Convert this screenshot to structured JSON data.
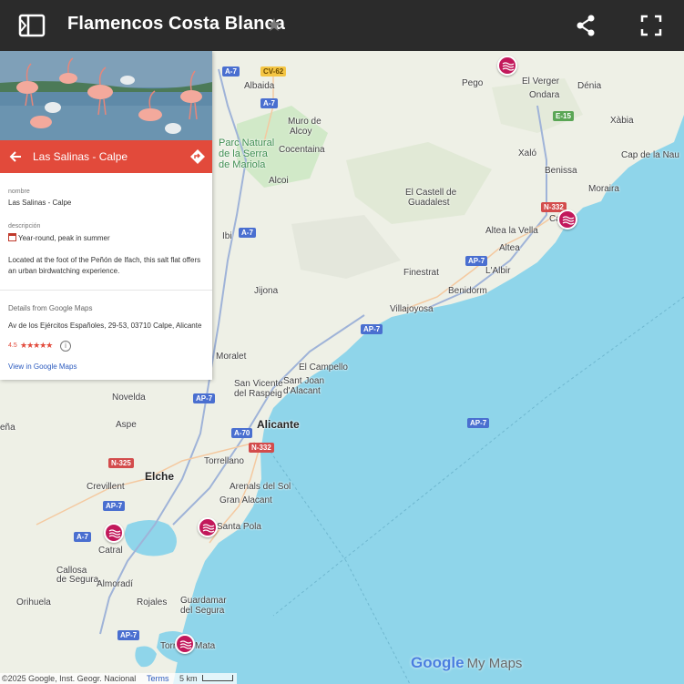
{
  "header": {
    "title": "Flamencos Costa Blanca",
    "icons": [
      "panel-toggle-icon",
      "star-icon",
      "share-icon",
      "fullscreen-icon"
    ]
  },
  "panel": {
    "title": "Las Salinas - Calpe",
    "name_label": "nombre",
    "name_value": "Las Salinas - Calpe",
    "desc_label": "descripción",
    "desc_value": "Year-round, peak in summer",
    "description": "Located at the foot of the Peñón de Ifach, this salt flat offers an urban birdwatching experience.",
    "details_label": "Details from Google Maps",
    "address": "Av de los Ejércitos Españoles, 29-53, 03710 Calpe, Alicante",
    "rating": "4.5",
    "stars": "★★★★★",
    "gmaps_link": "View in Google Maps",
    "accent": "#e24a3b"
  },
  "map": {
    "places": [
      {
        "name": "Villajoyosa"
      },
      {
        "name": "Pego"
      },
      {
        "name": "El Verger"
      },
      {
        "name": "Dénia"
      },
      {
        "name": "Ondara"
      },
      {
        "name": "Albaida"
      },
      {
        "name": "Xàbia"
      },
      {
        "name": "Muro de"
      },
      {
        "name": "Alcoy"
      },
      {
        "name": "Cocentaina"
      },
      {
        "name": "Xaló"
      },
      {
        "name": "Cap de la Nau"
      },
      {
        "name": "Alcoi"
      },
      {
        "name": "Benissa"
      },
      {
        "name": "Moraira"
      },
      {
        "name": "El Castell de"
      },
      {
        "name": "Guadalest"
      },
      {
        "name": "Altea la Vella"
      },
      {
        "name": "Ca"
      },
      {
        "name": "Ibi"
      },
      {
        "name": "Altea"
      },
      {
        "name": "Finestrat"
      },
      {
        "name": "L'Albir"
      },
      {
        "name": "Benidorm"
      },
      {
        "name": "Jijona"
      },
      {
        "name": "Villajoyosa"
      },
      {
        "name": "Moralet"
      },
      {
        "name": "El Campello"
      },
      {
        "name": "San Vicente"
      },
      {
        "name": "del Raspeig"
      },
      {
        "name": "Sant Joan"
      },
      {
        "name": "d'Alacant"
      },
      {
        "name": "Novelda"
      },
      {
        "name": "Aspe"
      },
      {
        "name": "Alicante"
      },
      {
        "name": "eña"
      },
      {
        "name": "Torrellano"
      },
      {
        "name": "Elche"
      },
      {
        "name": "Crevillent"
      },
      {
        "name": "Arenals del Sol"
      },
      {
        "name": "Gran Alacant"
      },
      {
        "name": "Santa Pola"
      },
      {
        "name": "Catral"
      },
      {
        "name": "Callosa"
      },
      {
        "name": "de Segura"
      },
      {
        "name": "Almoradí"
      },
      {
        "name": "Orihuela"
      },
      {
        "name": "Rojales"
      },
      {
        "name": "Guardamar"
      },
      {
        "name": "del Segura"
      },
      {
        "name": "Torre"
      },
      {
        "name": "Mata"
      }
    ],
    "park": [
      "Parc Natural",
      "de la Serra",
      "de Mariola"
    ],
    "roads": [
      "A-7",
      "CV-62",
      "A-7",
      "E-15",
      "N-332",
      "A-7",
      "AP-7",
      "AP-7",
      "AP-7",
      "AP-7",
      "A-70",
      "N-332",
      "N-325",
      "AP-7",
      "A-7",
      "AP-7"
    ],
    "markers": [
      "flamingo-site-pego",
      "flamingo-site-calpe",
      "flamingo-site-santa-pola",
      "flamingo-site-catral",
      "flamingo-site-torrevieja"
    ]
  },
  "footer": {
    "copyright": "©2025 Google, Inst. Geogr. Nacional",
    "terms": "Terms",
    "scale": "5 km",
    "brand_google": "Google",
    "brand_mymaps": "My Maps"
  },
  "colors": {
    "sea": "#8fd5ea",
    "land": "#eef0e6",
    "park": "#cde8c4",
    "marker": "#c2185b",
    "header": "#2b2b2b"
  }
}
